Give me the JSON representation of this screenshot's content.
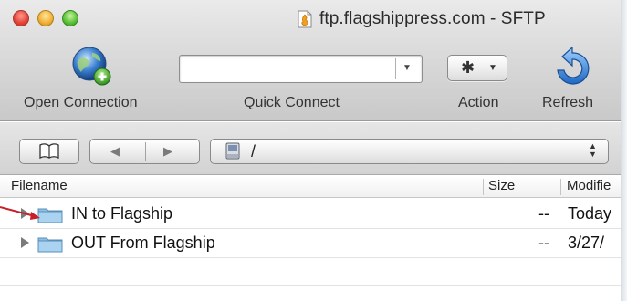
{
  "window": {
    "title": "ftp.flagshippress.com - SFTP"
  },
  "toolbar": {
    "open_connection_label": "Open Connection",
    "quick_connect_label": "Quick Connect",
    "quick_connect_value": "",
    "action_label": "Action",
    "refresh_label": "Refresh"
  },
  "navbar": {
    "path": "/"
  },
  "table": {
    "columns": [
      "Filename",
      "Size",
      "Modifie"
    ],
    "rows": [
      {
        "name": "IN to Flagship",
        "size": "--",
        "modified": "Today"
      },
      {
        "name": "OUT From Flagship",
        "size": "--",
        "modified": "3/27/"
      }
    ]
  },
  "icons": {
    "open_connection": "globe-with-plus-icon",
    "action": "gear-icon",
    "refresh": "refresh-arrow-icon",
    "bookmarks": "open-book-icon",
    "back": "back-arrow-icon",
    "forward": "forward-arrow-icon",
    "disk": "disk-icon",
    "folder": "folder-icon",
    "annotation": "red-arrow-icon"
  },
  "colors": {
    "annotation_arrow": "#c8202a",
    "folder_blue": "#7fb3d9"
  }
}
